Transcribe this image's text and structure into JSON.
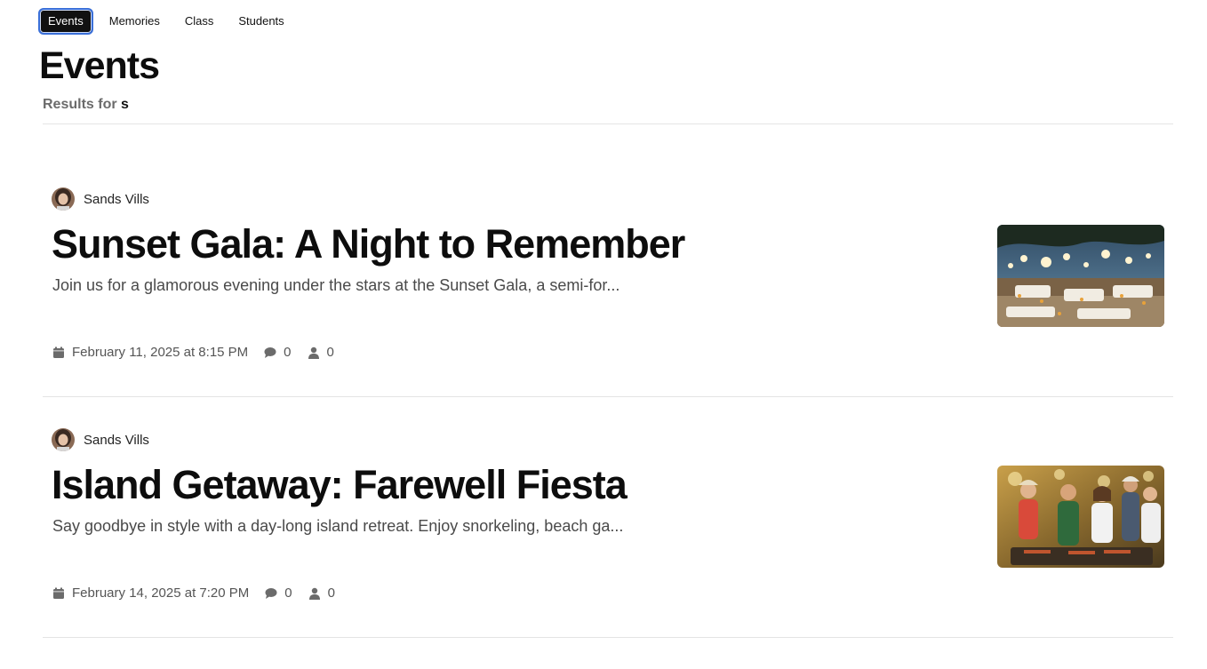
{
  "nav": {
    "tabs": [
      {
        "label": "Events",
        "active": true
      },
      {
        "label": "Memories",
        "active": false
      },
      {
        "label": "Class",
        "active": false
      },
      {
        "label": "Students",
        "active": false
      }
    ]
  },
  "page": {
    "title": "Events",
    "results_prefix": "Results for",
    "query": "s"
  },
  "events": [
    {
      "author": "Sands Vills",
      "title": "Sunset Gala: A Night to Remember",
      "excerpt": "Join us for a glamorous evening under the stars at the Sunset Gala, a semi-for...",
      "date": "February 11, 2025 at 8:15 PM",
      "comments": "0",
      "attendees": "0",
      "image": "outdoor-gala-lanterns"
    },
    {
      "author": "Sands Vills",
      "title": "Island Getaway: Farewell Fiesta",
      "excerpt": "Say goodbye in style with a day-long island retreat. Enjoy snorkeling, beach ga...",
      "date": "February 14, 2025 at 7:20 PM",
      "comments": "0",
      "attendees": "0",
      "image": "friends-barbecue-party"
    }
  ],
  "colors": {
    "active_tab_bg": "#111111",
    "focus_ring": "#3a6fd8",
    "text_muted": "#6b6b6b"
  }
}
